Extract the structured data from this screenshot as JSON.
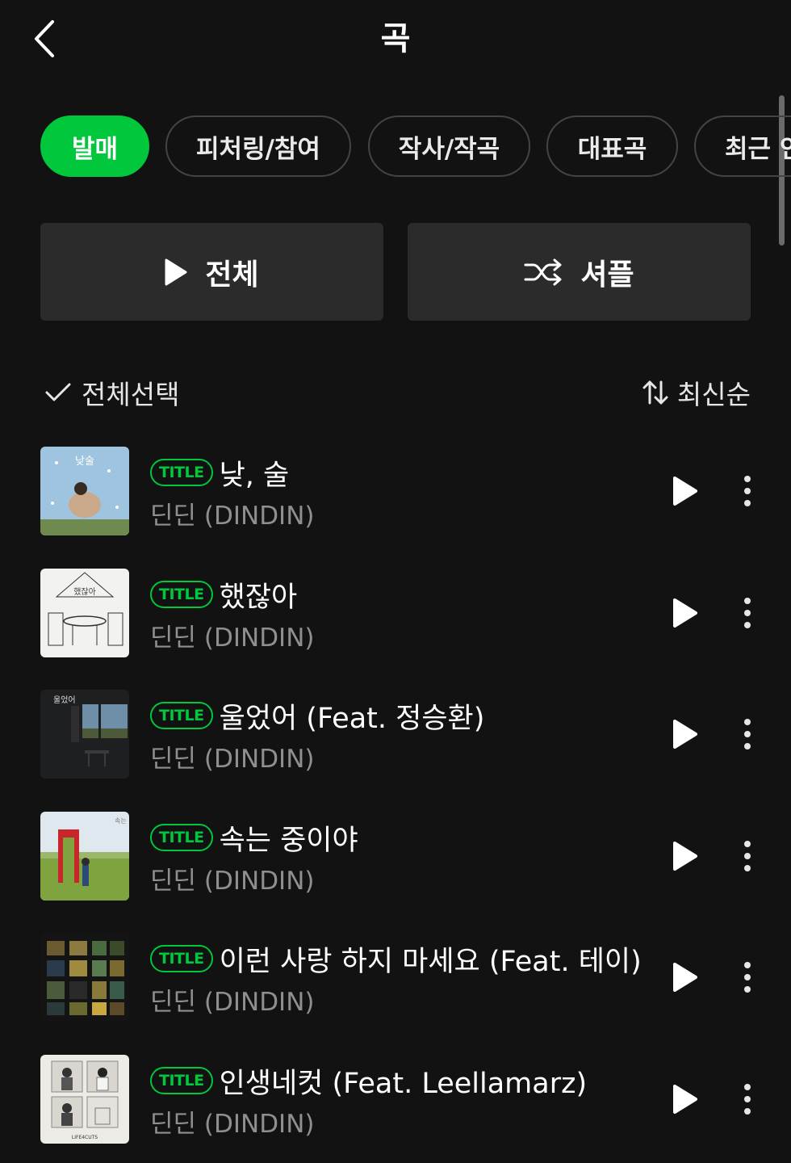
{
  "header": {
    "title": "곡"
  },
  "chips": [
    {
      "label": "발매",
      "active": true
    },
    {
      "label": "피처링/참여",
      "active": false
    },
    {
      "label": "작사/작곡",
      "active": false
    },
    {
      "label": "대표곡",
      "active": false
    },
    {
      "label": "최근 인",
      "active": false
    }
  ],
  "actions": {
    "play_all_label": "전체",
    "shuffle_label": "셔플"
  },
  "list_controls": {
    "select_all_label": "전체선택",
    "sort_label": "최신순"
  },
  "badge_label": "TITLE",
  "songs": [
    {
      "title": "낮, 술",
      "artist": "딘딘 (DINDIN)"
    },
    {
      "title": "했잖아",
      "artist": "딘딘 (DINDIN)"
    },
    {
      "title": "울었어 (Feat. 정승환)",
      "artist": "딘딘 (DINDIN)"
    },
    {
      "title": "속는 중이야",
      "artist": "딘딘 (DINDIN)"
    },
    {
      "title": "이런 사랑 하지 마세요 (Feat. 테이)",
      "artist": "딘딘 (DINDIN)"
    },
    {
      "title": "인생네컷 (Feat. Leellamarz)",
      "artist": "딘딘 (DINDIN)"
    }
  ],
  "colors": {
    "accent": "#00c73c",
    "background": "#121212",
    "button_bg": "#2b2b2b"
  }
}
